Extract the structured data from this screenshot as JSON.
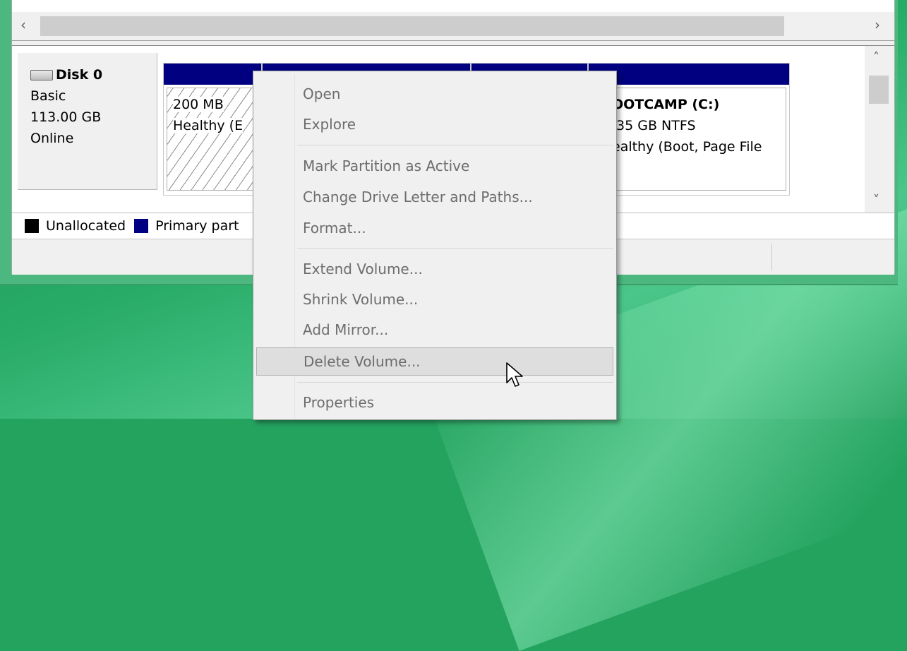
{
  "disk": {
    "name": "Disk 0",
    "type": "Basic",
    "size": "113.00 GB",
    "status": "Online"
  },
  "partitions": [
    {
      "line1": "200 MB",
      "line2": "Healthy (E"
    },
    {
      "line1": "",
      "line2": ""
    },
    {
      "line1": "",
      "line2": ""
    },
    {
      "title": "OOTCAMP  (C:)",
      "line1": ".35 GB NTFS",
      "line2": "ealthy (Boot, Page File"
    }
  ],
  "legend": {
    "unallocated": "Unallocated",
    "primary": "Primary part"
  },
  "colors": {
    "primary_partition": "#000080",
    "unallocated": "#000000",
    "desktop_green": "#24a35f"
  },
  "context_menu": {
    "items": [
      "Open",
      "Explore",
      "Mark Partition as Active",
      "Change Drive Letter and Paths...",
      "Format...",
      "Extend Volume...",
      "Shrink Volume...",
      "Add Mirror...",
      "Delete Volume...",
      "Properties"
    ],
    "hovered": "Delete Volume..."
  },
  "icons": {
    "scroll_left": "‹",
    "scroll_right": "›",
    "scroll_up": "˄",
    "scroll_down": "˅"
  }
}
